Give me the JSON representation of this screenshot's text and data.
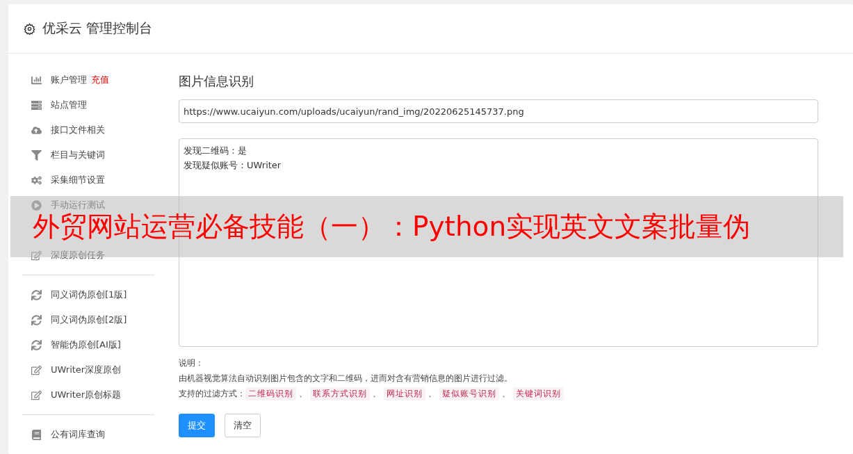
{
  "header": {
    "title": "优采云 管理控制台"
  },
  "sidebar": {
    "groups": [
      {
        "items": [
          {
            "label": "账户管理",
            "badge": "充值"
          },
          {
            "label": "站点管理"
          },
          {
            "label": "接口文件相关"
          },
          {
            "label": "栏目与关键词"
          },
          {
            "label": "采集细节设置"
          },
          {
            "label": "手动运行测试"
          },
          {
            "kind": "covered"
          },
          {
            "label": "深度原创任务"
          }
        ]
      },
      {
        "items": [
          {
            "label": "同义词伪原创[1版]"
          },
          {
            "label": "同义词伪原创[2版]"
          },
          {
            "label": "智能伪原创[AI版]"
          },
          {
            "label": "UWriter深度原创"
          },
          {
            "label": "UWriter原创标题"
          }
        ]
      },
      {
        "items": [
          {
            "label": "公有词库查询"
          }
        ]
      }
    ]
  },
  "main": {
    "title": "图片信息识别",
    "url_field": {
      "value": "https://www.ucaiyun.com/uploads/ucaiyun/rand_img/20220625145737.png"
    },
    "result_box": {
      "lines": [
        "发现二维码：是",
        "发现疑似账号：UWriter"
      ]
    },
    "notes": {
      "heading": "说明：",
      "description": "由机器视觉算法自动识别图片包含的文字和二维码，进而对含有营销信息的图片进行过滤。",
      "methods_label": "支持的过滤方式：",
      "methods": [
        "二维码识别",
        "联系方式识别",
        "网址识别",
        "疑似账号识别",
        "关键词识别"
      ],
      "separator": "、"
    },
    "buttons": [
      {
        "label": "提交",
        "kind": "primary"
      },
      {
        "label": "清空",
        "kind": "default"
      }
    ]
  },
  "banner": {
    "text": "外贸网站运营必备技能（一）：Python实现英文文案批量伪"
  }
}
